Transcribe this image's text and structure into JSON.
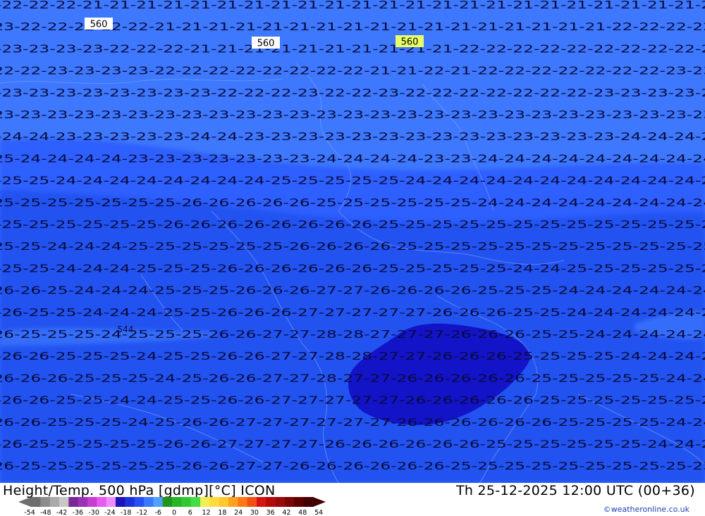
{
  "header": {
    "title": "Height/Temp. 500 hPa [gdmp][°C] ICON",
    "valid_time": "Th 25-12-2025 12:00 UTC (00+36)",
    "credit": "©weatheronline.co.uk"
  },
  "colors": {
    "background_light": "#3d78ff",
    "background_mid": "#2e5fff",
    "background_deep": "#2452f0",
    "cold_core": "#1313c8",
    "isotherm_digits": "#0a0a3a",
    "contour_label_bg": "#ffffff",
    "highlight_label_bg": "#e8ff66"
  },
  "contour_labels": [
    "560",
    "560",
    "560",
    "544"
  ],
  "isotherm_rows": [
    "-22-22-22-21-21-21-21-21-21-21-21-21-21-21-21-21-21-21-21-21-21-21-21-21-21-21-21",
    "-23-22-22-22-22-22-21-21-21-21-21-21-21-21-21-21-21-21-21-21-21-21-21-22-22-22-22",
    "-23-23-23-23-22-22-22-21-21-21-21-21-21-21-21-21-21-22-22-22-22-22-22-22-22-22-22",
    "-22-22-23-23-23-23-22-22-22-22-22-22-22-22-21-21-22-21-22-22-22-22-22-22-22-23-23",
    "-23-23-23-23-23-23-23-23-22-22-22-23-22-22-23-22-22-22-22-22-22-22-23-23-23-23-23",
    "-23-23-23-23-23-23-23-23-23-23-23-23-23-23-23-23-23-23-23-23-23-23-23-23-23-23-23",
    "-24-24-23-23-23-23-23-24-24-23-23-23-23-23-23-23-23-23-23-23-23-23-23-24-24-24-24",
    "-25-24-24-24-24-23-23-23-23-23-23-23-24-24-24-24-23-23-24-24-24-24-24-24-24-24-24",
    "-25-25-24-24-24-24-24-24-24-24-25-25-25-25-25-24-24-24-24-24-24-24-24-24-24-24-24",
    "-25-25-25-25-25-25-25-26-26-26-26-26-25-25-25-25-25-25-24-24-24-24-24-24-24-24-24",
    "-25-25-25-25-25-25-26-26-26-26-26-26-26-26-25-25-25-25-25-25-25-25-25-25-25-25-25",
    "-25-25-24-24-24-25-25-25-25-25-25-26-26-26-26-25-25-25-25-25-25-25-25-25-25-25-25",
    "-25-25-24-24-24-25-25-25-26-26-26-26-26-26-25-25-25-25-25-24-24-25-25-25-25-25-25",
    "-26-26-25-24-24-24-25-25-25-26-26-26-27-27-26-26-26-26-25-25-25-24-24-24-24-24-24",
    "-26-25-25-24-24-24-25-25-26-26-26-27-27-27-27-27-26-26-26-25-25-24-24-24-24-24-24",
    "-26-25-25-25-24-25-25-25-26-26-27-27-28-28-27-27-27-26-26-26-25-25-24-24-24-24-24",
    "-26-26-25-25-25-24-25-25-26-26-27-27-28-28-27-27-26-26-26-25-25-25-25-24-24-24-24",
    "-26-26-26-25-25-25-24-25-26-26-27-27-28-27-27-26-26-26-26-26-25-25-25-25-25-24-24",
    "-26-26-25-25-24-24-25-25-26-26-27-27-27-27-27-26-26-26-26-26-25-25-25-25-25-25-25",
    "-26-26-25-25-25-24-25-26-26-27-27-27-27-27-27-26-26-26-26-26-26-25-25-25-25-24-24",
    "-26-25-25-25-25-25-26-26-27-27-27-27-26-26-26-26-26-26-25-25-25-25-25-25-24-24-24",
    "-26-25-25-25-25-25-25-26-26-27-27-26-26-26-26-26-26-25-25-25-25-25-25-25-25-25-25"
  ],
  "legend": {
    "ticks": [
      "-54",
      "-48",
      "-42",
      "-36",
      "-30",
      "-24",
      "-18",
      "-12",
      "-6",
      "0",
      "6",
      "12",
      "18",
      "24",
      "30",
      "36",
      "42",
      "48",
      "54"
    ],
    "colors": [
      "#6e6e6e",
      "#8c8c8c",
      "#aaaaaa",
      "#c8c8c8",
      "#7a2896",
      "#9b32b4",
      "#c83cd2",
      "#e65af0",
      "#f08cff",
      "#1e14b4",
      "#1e32dc",
      "#2850f0",
      "#3c78ff",
      "#50a0ff",
      "#1e961e",
      "#28b428",
      "#32c832",
      "#46dc46",
      "#f0f050",
      "#ffdc3c",
      "#ffc832",
      "#ffa01e",
      "#ff7814",
      "#f05014",
      "#d21414",
      "#b40a0a",
      "#960a0a",
      "#7a0505",
      "#5a0000",
      "#420000"
    ]
  }
}
